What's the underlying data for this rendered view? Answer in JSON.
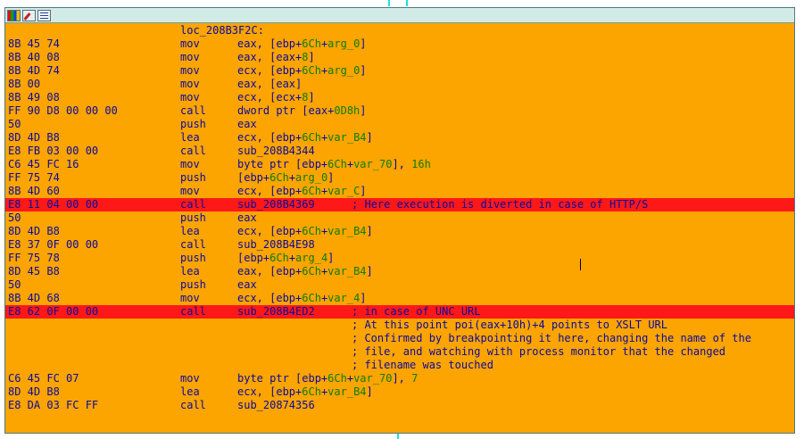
{
  "window": {
    "toolbar": [
      {
        "name": "graph-view-icon"
      },
      {
        "name": "edit-icon"
      },
      {
        "name": "text-view-icon"
      }
    ]
  },
  "listing": {
    "label": "loc_208B3F2C:",
    "rows": [
      {
        "bytes": "8B 45 74",
        "mn": "mov",
        "ops": [
          [
            "eax, [ebp+",
            ""
          ],
          [
            "6Ch",
            "g"
          ],
          [
            "+",
            ""
          ],
          [
            "arg_0",
            "g"
          ],
          [
            "]",
            ""
          ]
        ]
      },
      {
        "bytes": "8B 40 08",
        "mn": "mov",
        "ops": [
          [
            "eax, [eax+",
            ""
          ],
          [
            "8",
            "g"
          ],
          [
            "]",
            ""
          ]
        ]
      },
      {
        "bytes": "8B 4D 74",
        "mn": "mov",
        "ops": [
          [
            "ecx, [ebp+",
            ""
          ],
          [
            "6Ch",
            "g"
          ],
          [
            "+",
            ""
          ],
          [
            "arg_0",
            "g"
          ],
          [
            "]",
            ""
          ]
        ]
      },
      {
        "bytes": "8B 00",
        "mn": "mov",
        "ops": [
          [
            "eax, [eax]",
            ""
          ]
        ]
      },
      {
        "bytes": "8B 49 08",
        "mn": "mov",
        "ops": [
          [
            "ecx, [ecx+",
            ""
          ],
          [
            "8",
            "g"
          ],
          [
            "]",
            ""
          ]
        ]
      },
      {
        "bytes": "FF 90 D8 00 00 00",
        "mn": "call",
        "ops": [
          [
            "dword ptr [eax+",
            ""
          ],
          [
            "0D8h",
            "g"
          ],
          [
            "]",
            ""
          ]
        ]
      },
      {
        "bytes": "50",
        "mn": "push",
        "ops": [
          [
            "eax",
            ""
          ]
        ]
      },
      {
        "bytes": "8D 4D B8",
        "mn": "lea",
        "ops": [
          [
            "ecx, [ebp+",
            ""
          ],
          [
            "6Ch",
            "g"
          ],
          [
            "+",
            ""
          ],
          [
            "var_B4",
            "g"
          ],
          [
            "]",
            ""
          ]
        ]
      },
      {
        "bytes": "E8 FB 03 00 00",
        "mn": "call",
        "ops": [
          [
            "sub_208B4344",
            ""
          ]
        ]
      },
      {
        "bytes": "C6 45 FC 16",
        "mn": "mov",
        "ops": [
          [
            "byte ptr [ebp+",
            ""
          ],
          [
            "6Ch",
            "g"
          ],
          [
            "+",
            ""
          ],
          [
            "var_70",
            "g"
          ],
          [
            "], ",
            ""
          ],
          [
            "16h",
            "g"
          ]
        ]
      },
      {
        "bytes": "FF 75 74",
        "mn": "push",
        "ops": [
          [
            "[ebp+",
            ""
          ],
          [
            "6Ch",
            "g"
          ],
          [
            "+",
            ""
          ],
          [
            "arg_0",
            "g"
          ],
          [
            "]",
            ""
          ]
        ]
      },
      {
        "bytes": "8B 4D 60",
        "mn": "mov",
        "ops": [
          [
            "ecx, [ebp+",
            ""
          ],
          [
            "6Ch",
            "g"
          ],
          [
            "+",
            ""
          ],
          [
            "var_C",
            "g"
          ],
          [
            "]",
            ""
          ]
        ]
      },
      {
        "bytes": "E8 11 04 00 00",
        "mn": "call",
        "ops": [
          [
            "sub_208B4369",
            ""
          ]
        ],
        "cmt": "; Here execution is diverted in case of HTTP/S",
        "hl": true
      },
      {
        "bytes": "50",
        "mn": "push",
        "ops": [
          [
            "eax",
            ""
          ]
        ]
      },
      {
        "bytes": "8D 4D B8",
        "mn": "lea",
        "ops": [
          [
            "ecx, [ebp+",
            ""
          ],
          [
            "6Ch",
            "g"
          ],
          [
            "+",
            ""
          ],
          [
            "var_B4",
            "g"
          ],
          [
            "]",
            ""
          ]
        ]
      },
      {
        "bytes": "E8 37 0F 00 00",
        "mn": "call",
        "ops": [
          [
            "sub_208B4E98",
            ""
          ]
        ]
      },
      {
        "bytes": "FF 75 78",
        "mn": "push",
        "ops": [
          [
            "[ebp+",
            ""
          ],
          [
            "6Ch",
            "g"
          ],
          [
            "+",
            ""
          ],
          [
            "arg_4",
            "g"
          ],
          [
            "]",
            ""
          ]
        ]
      },
      {
        "bytes": "8D 45 B8",
        "mn": "lea",
        "ops": [
          [
            "eax, [ebp+",
            ""
          ],
          [
            "6Ch",
            "g"
          ],
          [
            "+",
            ""
          ],
          [
            "var_B4",
            "g"
          ],
          [
            "]",
            ""
          ]
        ]
      },
      {
        "bytes": "50",
        "mn": "push",
        "ops": [
          [
            "eax",
            ""
          ]
        ]
      },
      {
        "bytes": "8B 4D 68",
        "mn": "mov",
        "ops": [
          [
            "ecx, [ebp+",
            ""
          ],
          [
            "6Ch",
            "g"
          ],
          [
            "+",
            ""
          ],
          [
            "var_4",
            "g"
          ],
          [
            "]",
            ""
          ]
        ]
      },
      {
        "bytes": "E8 62 0F 00 00",
        "mn": "call",
        "ops": [
          [
            "sub_208B4ED2",
            ""
          ]
        ],
        "cmt": "; in case of UNC URL",
        "hl": true
      },
      {
        "bytes": "",
        "mn": "",
        "ops": [],
        "cmt": "; At this point poi(eax+10h)+4 points to XSLT URL"
      },
      {
        "bytes": "",
        "mn": "",
        "ops": [],
        "cmt": "; Confirmed by breakpointing it here, changing the name of the"
      },
      {
        "bytes": "",
        "mn": "",
        "ops": [],
        "cmt": "; file, and watching with process monitor that the changed"
      },
      {
        "bytes": "",
        "mn": "",
        "ops": [],
        "cmt": "; filename was touched"
      },
      {
        "bytes": "C6 45 FC 07",
        "mn": "mov",
        "ops": [
          [
            "byte ptr [ebp+",
            ""
          ],
          [
            "6Ch",
            "g"
          ],
          [
            "+",
            ""
          ],
          [
            "var_70",
            "g"
          ],
          [
            "], ",
            ""
          ],
          [
            "7",
            "g"
          ]
        ]
      },
      {
        "bytes": "8D 4D B8",
        "mn": "lea",
        "ops": [
          [
            "ecx, [ebp+",
            ""
          ],
          [
            "6Ch",
            "g"
          ],
          [
            "+",
            ""
          ],
          [
            "var_B4",
            "g"
          ],
          [
            "]",
            ""
          ]
        ]
      },
      {
        "bytes": "E8 DA 03 FC FF",
        "mn": "call",
        "ops": [
          [
            "sub_20874356",
            ""
          ]
        ]
      }
    ]
  },
  "colors": {
    "background": "#fca400",
    "highlight": "#ff1818",
    "text": "#0a0aa0",
    "numeric": "#0a7e0a"
  }
}
